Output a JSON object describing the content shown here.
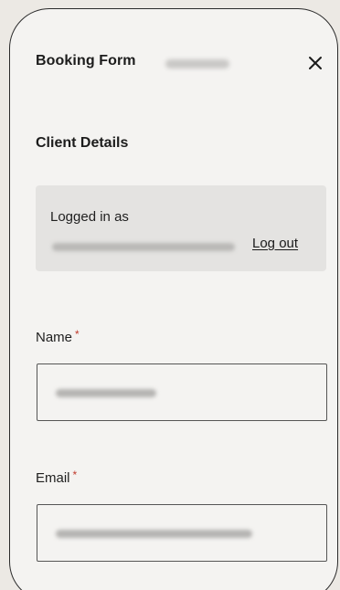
{
  "header": {
    "title": "Booking Form",
    "close_icon": "close-icon"
  },
  "client_details": {
    "title": "Client Details",
    "logged_in_label": "Logged in as",
    "logout_label": "Log out"
  },
  "fields": {
    "name": {
      "label": "Name",
      "required_marker": "*"
    },
    "email": {
      "label": "Email",
      "required_marker": "*"
    }
  },
  "colors": {
    "modal_bg": "#f4f3f1",
    "login_box_bg": "#e4e3e1",
    "required_marker": "#c0392b",
    "text": "#1c1c1c"
  }
}
